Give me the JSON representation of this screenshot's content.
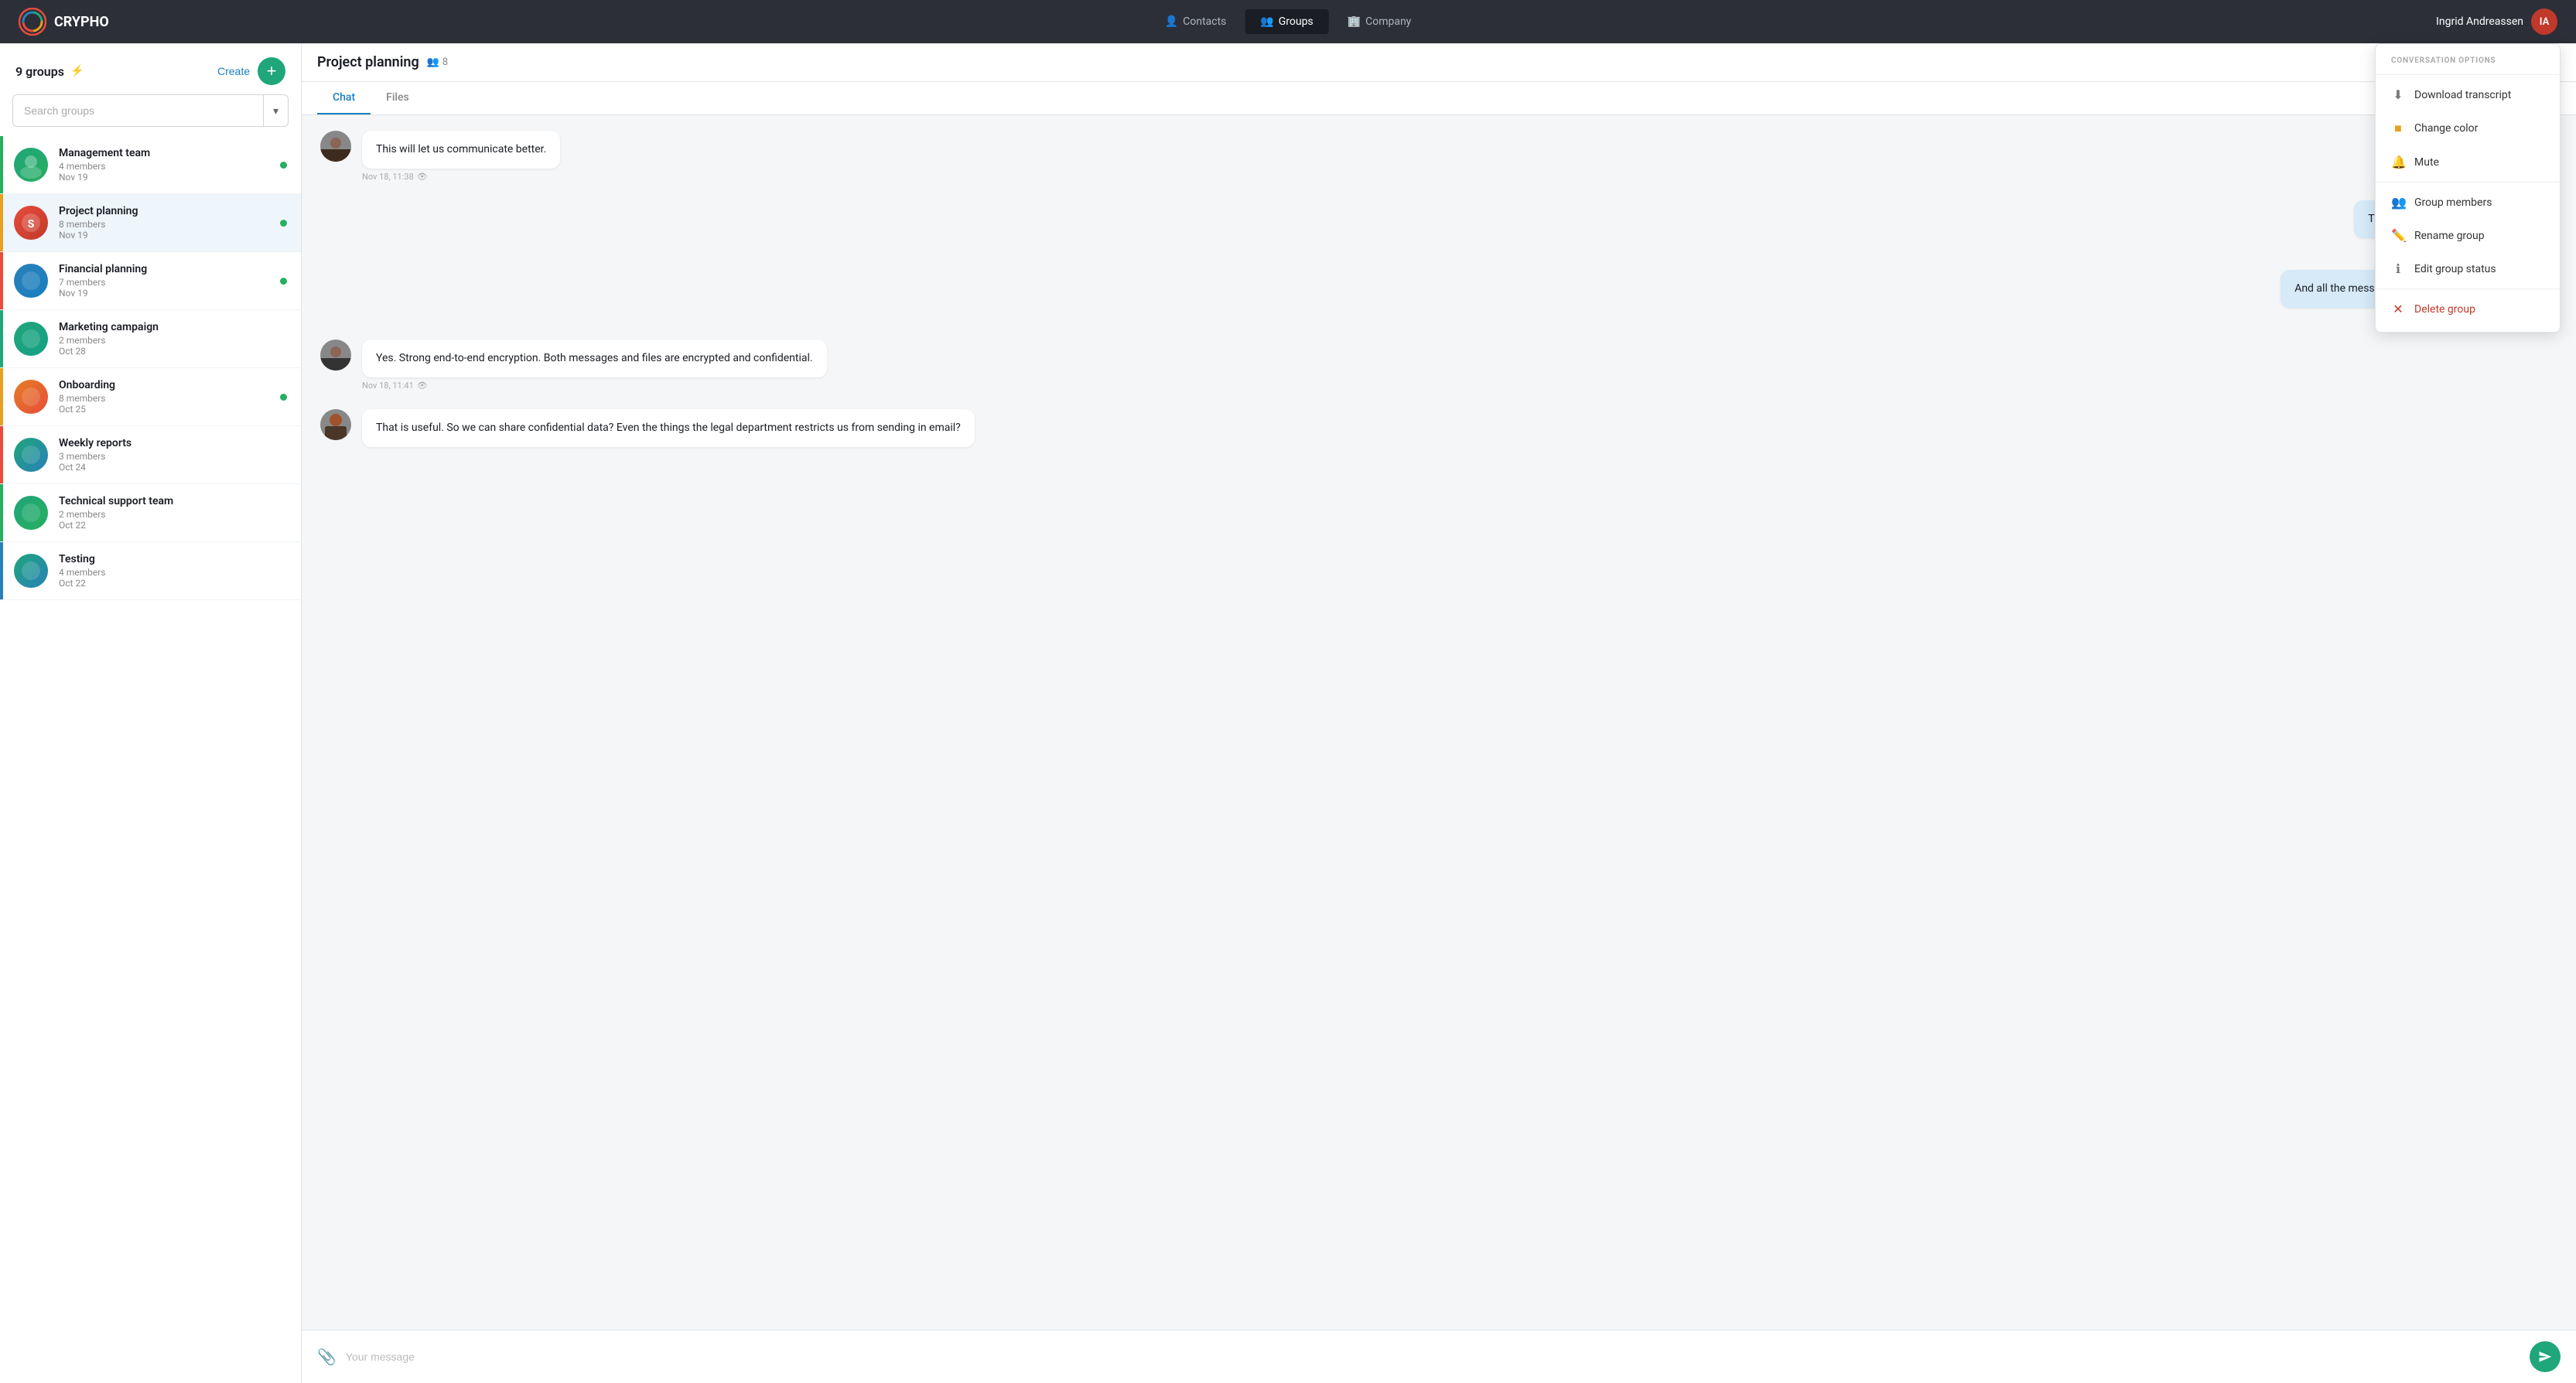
{
  "app": {
    "name": "CRYPHO"
  },
  "nav": {
    "links": [
      {
        "id": "contacts",
        "label": "Contacts",
        "icon": "👤",
        "active": false
      },
      {
        "id": "groups",
        "label": "Groups",
        "icon": "👥",
        "active": true
      },
      {
        "id": "company",
        "label": "Company",
        "icon": "🏢",
        "active": false
      }
    ],
    "user": {
      "name": "Ingrid Andreassen",
      "initials": "IA"
    }
  },
  "sidebar": {
    "title": "9 groups",
    "create_label": "Create",
    "search_placeholder": "Search groups",
    "groups": [
      {
        "id": "management",
        "name": "Management team",
        "members": "4 members",
        "date": "Nov 19",
        "online": true,
        "color": "#27ae60",
        "bar": "#27ae60",
        "avatar_class": "avatar-management"
      },
      {
        "id": "project",
        "name": "Project planning",
        "members": "8 members",
        "date": "Nov 19",
        "online": true,
        "color": "#e74c3c",
        "bar": "#e8a020",
        "avatar_class": "avatar-project",
        "active": true
      },
      {
        "id": "financial",
        "name": "Financial planning",
        "members": "7 members",
        "date": "Nov 19",
        "online": true,
        "color": "#2980b9",
        "bar": "#e74c3c",
        "avatar_class": "avatar-financial"
      },
      {
        "id": "marketing",
        "name": "Marketing campaign",
        "members": "2 members",
        "date": "Oct 28",
        "online": false,
        "color": "#1fa67a",
        "bar": "#1fa67a",
        "avatar_class": "avatar-marketing"
      },
      {
        "id": "onboarding",
        "name": "Onboarding",
        "members": "8 members",
        "date": "Oct 25",
        "online": true,
        "color": "#e67e22",
        "bar": "#e8a020",
        "avatar_class": "avatar-onboarding"
      },
      {
        "id": "weekly",
        "name": "Weekly reports",
        "members": "3 members",
        "date": "Oct 24",
        "online": false,
        "color": "#1fa67a",
        "bar": "#e74c3c",
        "avatar_class": "avatar-weekly"
      },
      {
        "id": "technical",
        "name": "Technical support team",
        "members": "2 members",
        "date": "Oct 22",
        "online": false,
        "color": "#1fa67a",
        "bar": "#27ae60",
        "avatar_class": "avatar-technical"
      },
      {
        "id": "testing",
        "name": "Testing",
        "members": "4 members",
        "date": "Oct 22",
        "online": false,
        "color": "#1fa67a",
        "bar": "#2980b9",
        "avatar_class": "avatar-testing"
      }
    ]
  },
  "chat": {
    "title": "Project planning",
    "members_count": "8",
    "tabs": [
      {
        "id": "chat",
        "label": "Chat",
        "active": true
      },
      {
        "id": "files",
        "label": "Files",
        "active": false
      }
    ],
    "messages": [
      {
        "id": "msg1",
        "type": "received",
        "text": "This will let us communicate better.",
        "time": "Nov 18, 11:38",
        "show_eye": true
      },
      {
        "id": "msg2",
        "type": "sent",
        "text": "Thanks for inviting us, Jon. This look",
        "time": "N",
        "show_eye": false
      },
      {
        "id": "msg3",
        "type": "sent",
        "text": "And all the messages are end-to-end encrypted so o",
        "time": "N",
        "show_eye": false
      },
      {
        "id": "msg4",
        "type": "received",
        "text": "Yes. Strong end-to-end encryption. Both messages and files are encrypted and confidential.",
        "time": "Nov 18, 11:41",
        "show_eye": true
      },
      {
        "id": "msg5",
        "type": "received",
        "text": "That is useful. So we can share confidential data? Even the things the legal department restricts us from sending in email?",
        "time": "",
        "show_eye": false
      }
    ],
    "input_placeholder": "Your message"
  },
  "conversation_options": {
    "title": "CONVERSATION OPTIONS",
    "items": [
      {
        "id": "download",
        "label": "Download transcript",
        "icon": "⬇",
        "danger": false
      },
      {
        "id": "color",
        "label": "Change color",
        "icon": "🟨",
        "danger": false
      },
      {
        "id": "mute",
        "label": "Mute",
        "icon": "🔔",
        "danger": false
      },
      {
        "id": "members",
        "label": "Group members",
        "icon": "👥",
        "danger": false
      },
      {
        "id": "rename",
        "label": "Rename group",
        "icon": "✏️",
        "danger": false
      },
      {
        "id": "status",
        "label": "Edit group status",
        "icon": "ℹ",
        "danger": false
      },
      {
        "id": "delete",
        "label": "Delete group",
        "icon": "✕",
        "danger": true
      }
    ]
  }
}
